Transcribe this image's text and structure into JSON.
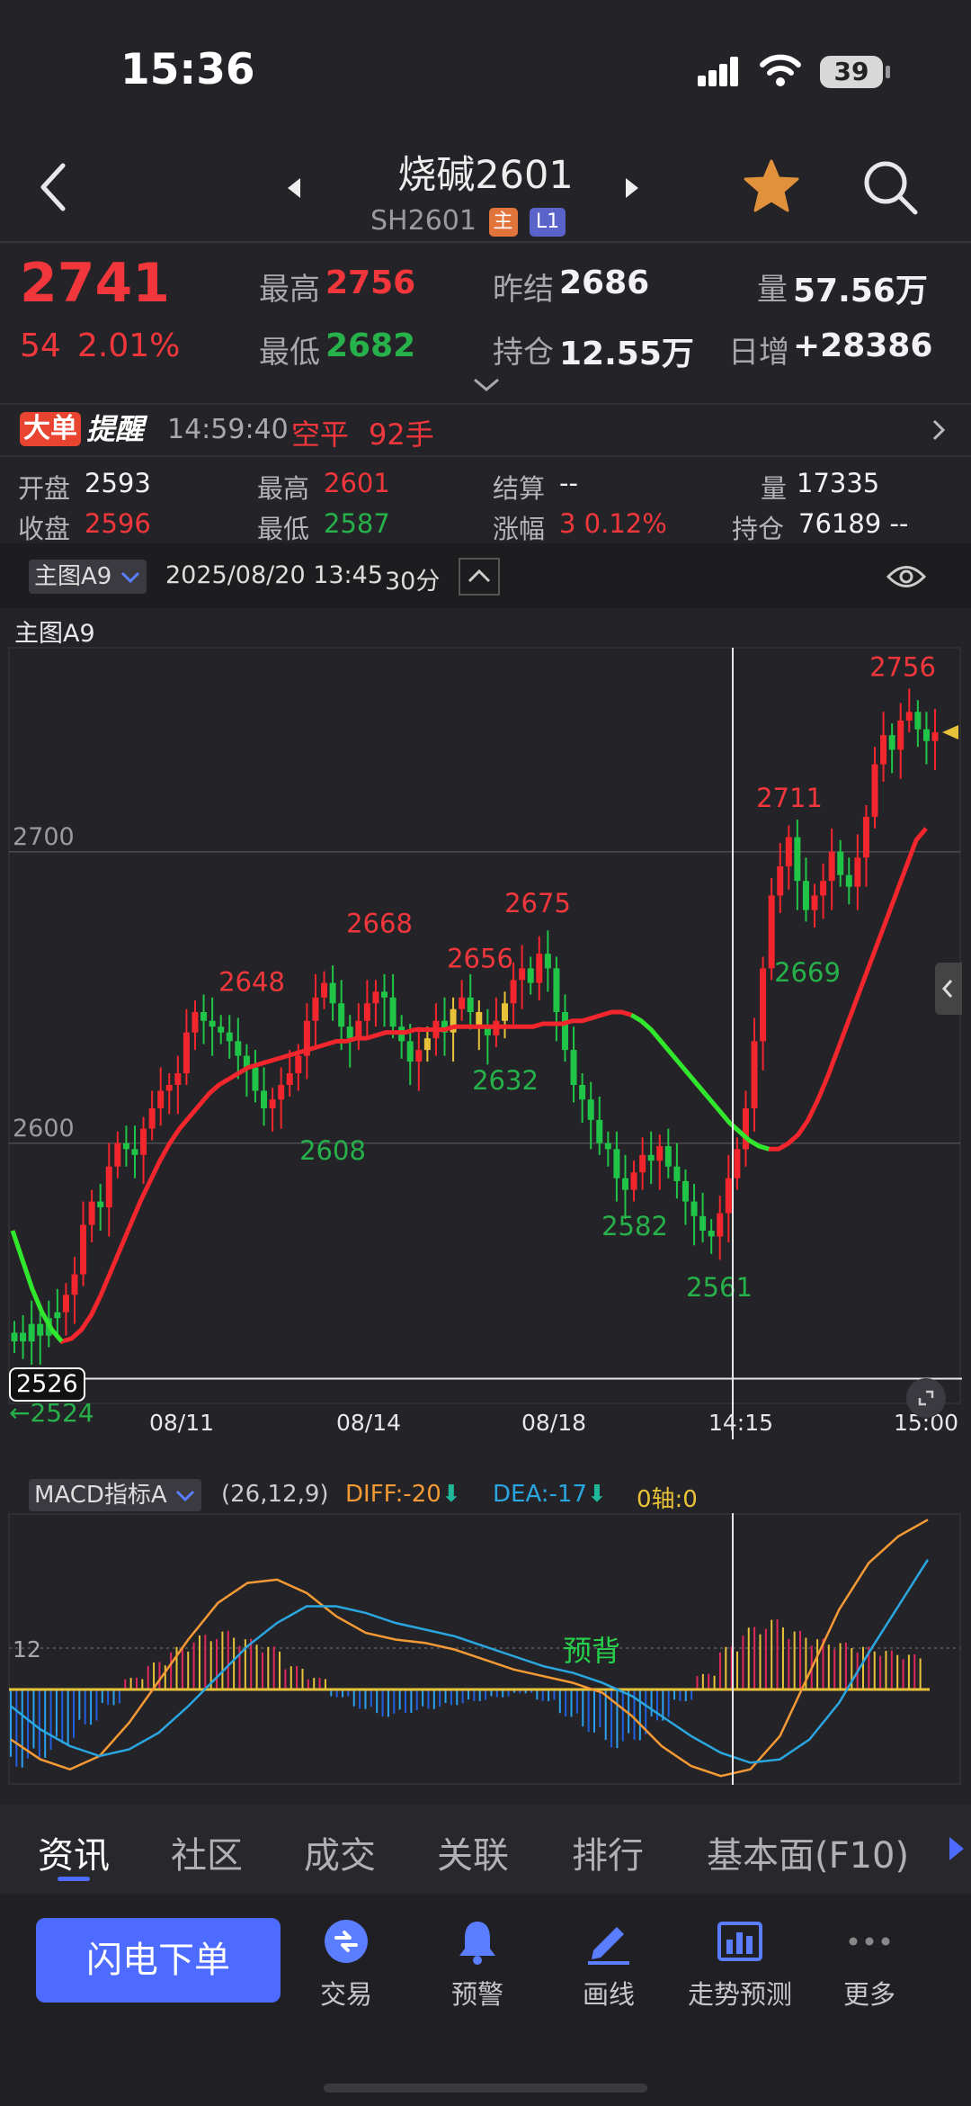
{
  "status_bar": {
    "time": "15:36",
    "battery": "39"
  },
  "header": {
    "title": "烧碱2601",
    "code": "SH2601",
    "tag_main": "主",
    "tag_level": "L1",
    "colors": {
      "star": "#e0913a",
      "tag_main": "#e0743a",
      "tag_level": "#5a63c9"
    }
  },
  "quote": {
    "price": "2741",
    "change": "54",
    "change_pct": "2.01%",
    "high_label": "最高",
    "high": "2756",
    "low_label": "最低",
    "low": "2682",
    "prev_settle_label": "昨结",
    "prev_settle": "2686",
    "oi_label": "持仓",
    "oi": "12.55万",
    "vol_label": "量",
    "vol": "57.56万",
    "daily_inc_label": "日增",
    "daily_inc": "+28386"
  },
  "alert": {
    "badge1": "大单",
    "badge2": "提醒",
    "time": "14:59:40",
    "type": "空平",
    "lots": "92手"
  },
  "bar_info": {
    "open_label": "开盘",
    "open": "2593",
    "high_label": "最高",
    "high": "2601",
    "settle_label": "结算",
    "settle": "--",
    "vol_label": "量",
    "vol": "17335",
    "close_label": "收盘",
    "close": "2596",
    "low_label": "最低",
    "low": "2587",
    "chg_label": "涨幅",
    "chg": "3 0.12%",
    "oi_label": "持仓",
    "oi": "76189 --"
  },
  "chart_toolbar": {
    "indicator": "主图A9",
    "datetime": "2025/08/20 13:45",
    "period": "30分"
  },
  "main_chart_label": "主图A9",
  "macd_header": {
    "name": "MACD指标A",
    "params": "(26,12,9)",
    "diff": "DIFF:-20",
    "dea": "DEA:-17",
    "axis": "0轴:0"
  },
  "macd_annotation": "预背",
  "macd_ref_label": "12",
  "crosshair_price": "2526",
  "arrow_label": "←2524",
  "chart_data": [
    {
      "type": "candlestick",
      "title": "主图A9",
      "y_ticks": [
        2700,
        2600
      ],
      "ylim": [
        2520,
        2770
      ],
      "x_ticks": [
        "08/11",
        "08/14",
        "08/18",
        "14:15",
        "15:00"
      ],
      "annotations": [
        {
          "text": "2648",
          "value": 2648,
          "color": "red"
        },
        {
          "text": "2668",
          "value": 2668,
          "color": "red"
        },
        {
          "text": "2656",
          "value": 2656,
          "color": "red"
        },
        {
          "text": "2675",
          "value": 2675,
          "color": "red"
        },
        {
          "text": "2711",
          "value": 2711,
          "color": "red"
        },
        {
          "text": "2756",
          "value": 2756,
          "color": "red"
        },
        {
          "text": "2608",
          "value": 2608,
          "color": "green"
        },
        {
          "text": "2632",
          "value": 2632,
          "color": "green"
        },
        {
          "text": "2582",
          "value": 2582,
          "color": "green"
        },
        {
          "text": "2561",
          "value": 2561,
          "color": "green"
        },
        {
          "text": "2669",
          "value": 2669,
          "color": "green"
        }
      ],
      "close_series": [
        2535,
        2532,
        2538,
        2534,
        2540,
        2542,
        2548,
        2555,
        2572,
        2580,
        2578,
        2592,
        2600,
        2598,
        2596,
        2605,
        2612,
        2618,
        2620,
        2624,
        2638,
        2645,
        2642,
        2640,
        2638,
        2635,
        2630,
        2626,
        2618,
        2612,
        2615,
        2620,
        2624,
        2630,
        2642,
        2650,
        2655,
        2648,
        2640,
        2636,
        2642,
        2648,
        2652,
        2650,
        2640,
        2635,
        2628,
        2632,
        2636,
        2642,
        2638,
        2646,
        2650,
        2645,
        2640,
        2637,
        2642,
        2648,
        2656,
        2660,
        2655,
        2665,
        2660,
        2645,
        2632,
        2620,
        2615,
        2608,
        2600,
        2598,
        2588,
        2584,
        2590,
        2596,
        2594,
        2599,
        2592,
        2587,
        2580,
        2575,
        2570,
        2568,
        2576,
        2588,
        2598,
        2612,
        2635,
        2660,
        2685,
        2695,
        2705,
        2690,
        2680,
        2685,
        2690,
        2700,
        2692,
        2688,
        2698,
        2712,
        2730,
        2740,
        2735,
        2745,
        2748,
        2742,
        2738,
        2741
      ],
      "ma_series": [
        2570,
        2560,
        2550,
        2542,
        2536,
        2532,
        2533,
        2536,
        2541,
        2548,
        2556,
        2564,
        2572,
        2580,
        2587,
        2594,
        2600,
        2605,
        2609,
        2613,
        2617,
        2620,
        2622,
        2624,
        2626,
        2627,
        2628,
        2629,
        2630,
        2631,
        2632,
        2633,
        2634,
        2635,
        2635,
        2636,
        2636,
        2637,
        2638,
        2638,
        2638,
        2639,
        2639,
        2639,
        2639,
        2640,
        2640,
        2640,
        2640,
        2640,
        2640,
        2640,
        2640,
        2640,
        2641,
        2641,
        2641,
        2642,
        2642,
        2643,
        2644,
        2645,
        2645,
        2644,
        2642,
        2639,
        2635,
        2631,
        2627,
        2623,
        2619,
        2615,
        2611,
        2607,
        2604,
        2601,
        2599,
        2598,
        2598,
        2600,
        2603,
        2608,
        2615,
        2623,
        2632,
        2641,
        2650,
        2659,
        2668,
        2677,
        2686,
        2695,
        2704,
        2708
      ],
      "series": [
        {
          "name": "主图A9",
          "values": []
        }
      ]
    },
    {
      "type": "bar",
      "title": "MACD指标A",
      "series": [
        {
          "name": "DIFF",
          "values": [
            -30,
            -42,
            -48,
            -40,
            -20,
            5,
            30,
            52,
            64,
            66,
            58,
            44,
            34,
            30,
            28,
            24,
            18,
            12,
            8,
            4,
            -2,
            -16,
            -34,
            -46,
            -52,
            -48,
            -28,
            10,
            48,
            76,
            92,
            102
          ]
        },
        {
          "name": "DEA",
          "values": [
            -10,
            -24,
            -34,
            -40,
            -36,
            -26,
            -10,
            8,
            26,
            40,
            50,
            50,
            46,
            40,
            36,
            32,
            26,
            20,
            14,
            10,
            4,
            -4,
            -16,
            -28,
            -38,
            -44,
            -42,
            -30,
            -8,
            22,
            50,
            78
          ]
        }
      ],
      "histogram": [
        -40,
        -35,
        -28,
        -18,
        -8,
        6,
        14,
        22,
        28,
        30,
        26,
        22,
        12,
        6,
        -4,
        -10,
        -14,
        -12,
        -10,
        -8,
        -6,
        -4,
        -2,
        -6,
        -14,
        -22,
        -30,
        -26,
        -16,
        -6,
        8,
        22,
        32,
        36,
        30,
        26,
        24,
        22,
        20,
        18
      ]
    }
  ],
  "tabs": [
    "资讯",
    "社区",
    "成交",
    "关联",
    "排行",
    "基本面(F10)"
  ],
  "bottom_nav": {
    "order_button": "闪电下单",
    "items": [
      "交易",
      "预警",
      "画线",
      "走势预测",
      "更多"
    ]
  }
}
